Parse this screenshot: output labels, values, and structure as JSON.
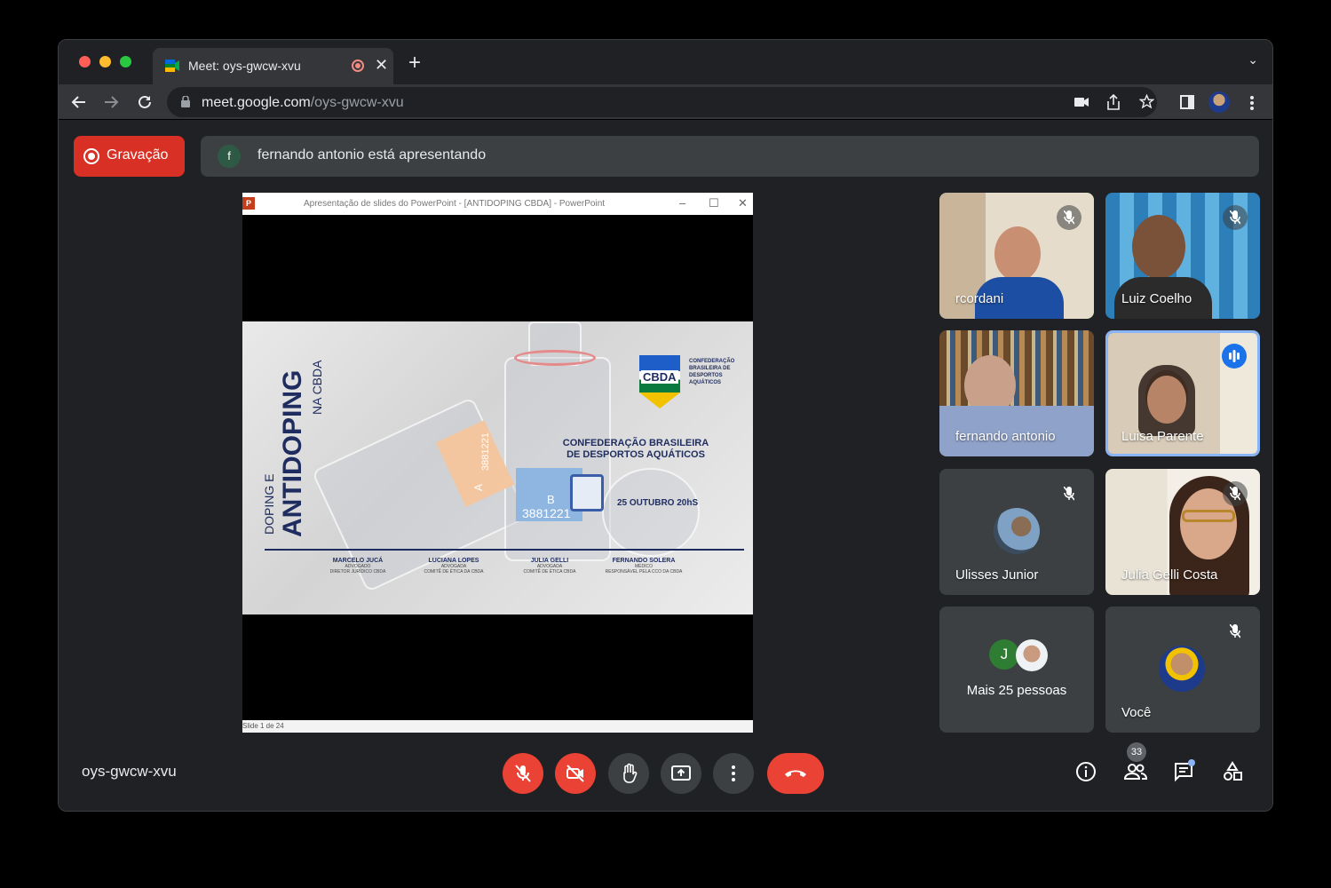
{
  "browser": {
    "tab_title": "Meet: oys-gwcw-xvu",
    "tab_close": "✕",
    "new_tab": "+",
    "url_host": "meet.google.com",
    "url_path": "/oys-gwcw-xvu"
  },
  "meet": {
    "record_label": "Gravação",
    "presenter_initial": "f",
    "presenter_text": "fernando antonio está apresentando",
    "meeting_code": "oys-gwcw-xvu",
    "participants_count": "33"
  },
  "ppt": {
    "window_title": "Apresentação de slides do PowerPoint - [ANTIDOPING CBDA] - PowerPoint",
    "status": "Slide 1 de 24",
    "slide": {
      "title_top": "DOPING E",
      "title_main": "ANTIDOPING",
      "title_sub": "NA CBDA",
      "logo": "CBDA",
      "logo_side": "CONFEDERAÇÃO BRASILEIRA DE DESPORTOS AQUÁTICOS",
      "heading": "CONFEDERAÇÃO BRASILEIRA DE DESPORTOS AQUÁTICOS",
      "date": "25 OUTUBRO 20hS",
      "label_a": "A",
      "label_b": "B",
      "code_a": "3881221",
      "code_b": "3881221",
      "people": [
        {
          "name": "MARCELO JUCÁ",
          "role1": "ADVOGADO",
          "role2": "DIRETOR JURÍDICO CBDA"
        },
        {
          "name": "LUCIANA LOPES",
          "role1": "ADVOGADA",
          "role2": "COMITÊ DE ÉTICA DA CBDA"
        },
        {
          "name": "JULIA GELLI",
          "role1": "ADVOGADA",
          "role2": "COMITÊ DE ÉTICA CBDA"
        },
        {
          "name": "FERNANDO SOLERA",
          "role1": "MÉDICO",
          "role2": "RESPONSÁVEL PELA CCO DA CBDA"
        }
      ]
    }
  },
  "participants": [
    {
      "name": "rcordani"
    },
    {
      "name": "Luiz Coelho"
    },
    {
      "name": "fernando antonio"
    },
    {
      "name": "Luisa Parente"
    },
    {
      "name": "Ulisses Junior"
    },
    {
      "name": "Julia Gelli Costa"
    },
    {
      "name": "Mais 25 pessoas",
      "initial": "J"
    },
    {
      "name": "Você"
    }
  ],
  "colors": {
    "meet_bg": "#202124",
    "tile_bg": "#3c4043",
    "danger": "#ea4335",
    "speaking": "#8ab4f8",
    "slide_navy": "#1e2c5f"
  },
  "icons": [
    "back-icon",
    "forward-icon",
    "reload-icon",
    "lock-icon",
    "camera-icon",
    "share-icon",
    "star-icon",
    "sidepanel-icon",
    "menu-icon",
    "mic-off-icon",
    "cam-off-icon",
    "hand-icon",
    "present-icon",
    "more-icon",
    "end-call-icon",
    "info-icon",
    "people-icon",
    "chat-icon",
    "activities-icon"
  ]
}
